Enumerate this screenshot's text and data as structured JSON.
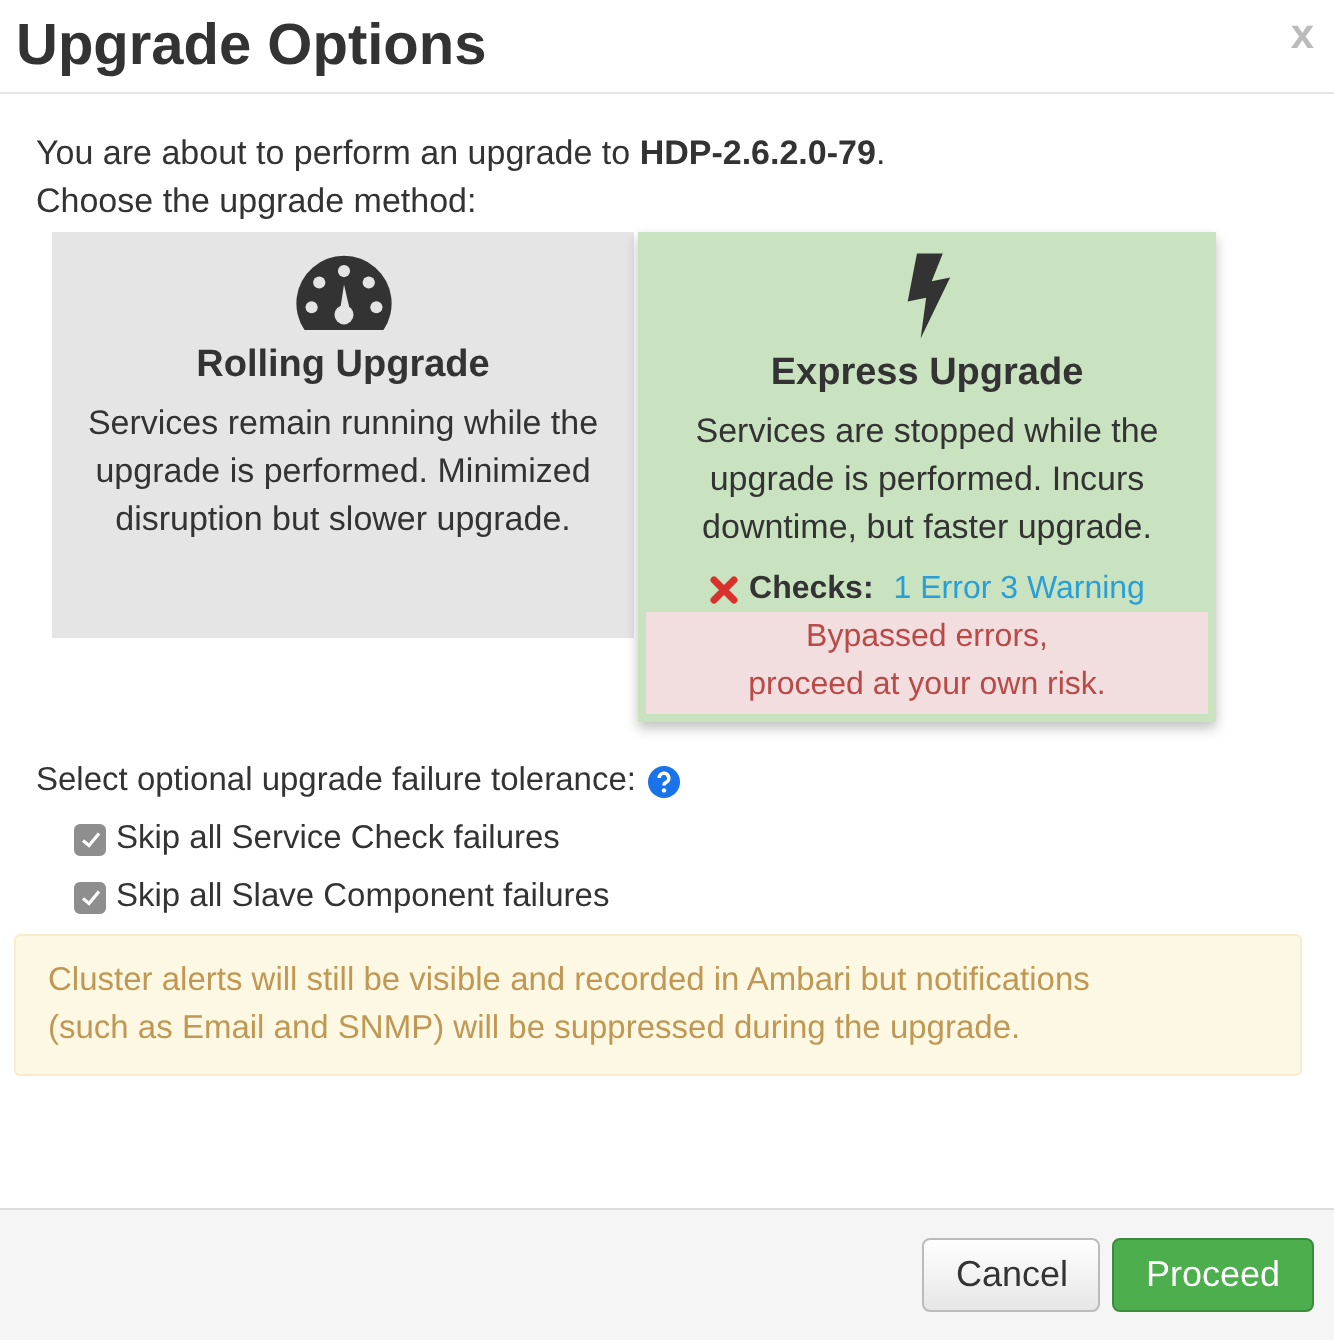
{
  "dialog": {
    "title": "Upgrade Options",
    "close": "x"
  },
  "intro": "You are about to perform an upgrade to **HDP-2.6.2.0-79**.",
  "prompt": "Choose the upgrade method:",
  "methods": [
    {
      "kind": "rolling",
      "title": "Rolling Upgrade",
      "description": "Services remain running while the upgrade is performed. Minimized disruption but slower upgrade.",
      "selected": false
    },
    {
      "kind": "express",
      "title": "Express Upgrade",
      "description": "Services are stopped while the upgrade is performed. Incurs downtime, but faster upgrade.",
      "selected": true,
      "checks": {
        "label": "Checks:",
        "result": "1 Error 3 Warning",
        "failed": true
      },
      "alert": "Bypassed errors,\nproceed at your own risk."
    }
  ],
  "tolerance": {
    "label": "Select optional upgrade failure tolerance:",
    "options": [
      {
        "label": "Skip all Service Check failures",
        "checked": true
      },
      {
        "label": "Skip all Slave Component failures",
        "checked": true
      }
    ]
  },
  "notice": "Cluster alerts will still be visible and recorded in Ambari but notifications\n(such as Email and SNMP) will be suppressed during the upgrade.",
  "buttons": [
    {
      "label": "Cancel",
      "kind": "default"
    },
    {
      "label": "Proceed",
      "kind": "primary"
    }
  ]
}
